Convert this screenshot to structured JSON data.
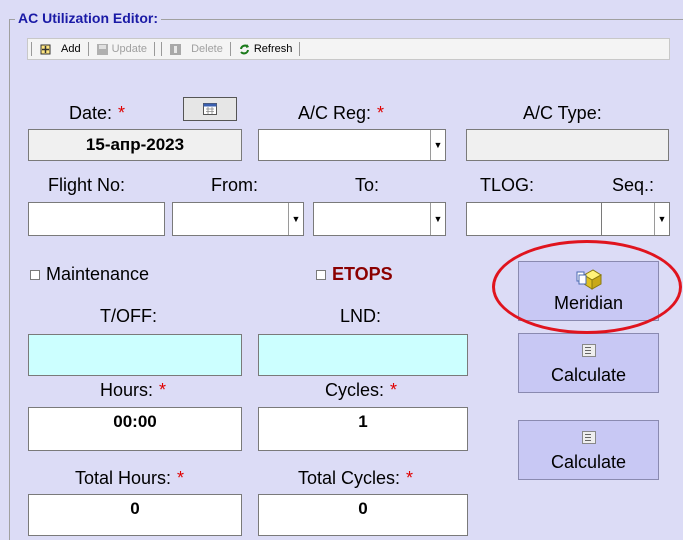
{
  "panel_title": "AC Utilization Editor:",
  "toolbar": {
    "add_label": "Add",
    "update_label": "Update",
    "delete_label": "Delete",
    "refresh_label": "Refresh"
  },
  "form": {
    "date_label": "Date:",
    "date_value": "15-апр-2023",
    "acreg_label": "A/C Reg:",
    "actype_label": "A/C Type:",
    "flightno_label": "Flight No:",
    "from_label": "From:",
    "to_label": "To:",
    "tlog_label": "TLOG:",
    "seq_label": "Seq.:",
    "maintenance_label": "Maintenance",
    "etops_label": "ETOPS",
    "toff_label": "T/OFF:",
    "lnd_label": "LND:",
    "hours_label": "Hours:",
    "hours_value": "00:00",
    "cycles_label": "Cycles:",
    "cycles_value": "1",
    "total_hours_label": "Total Hours:",
    "total_hours_value": "0",
    "total_cycles_label": "Total Cycles:",
    "total_cycles_value": "0",
    "required_marker": "*"
  },
  "buttons": {
    "meridian_label": "Meridian",
    "calculate1_label": "Calculate",
    "calculate2_label": "Calculate"
  },
  "colors": {
    "background": "#dcdcf6",
    "title": "#1a1aa6",
    "required": "#e00000",
    "etops": "#8b0000",
    "time_field": "#ccffff",
    "annotation_circle": "#e0141e"
  }
}
